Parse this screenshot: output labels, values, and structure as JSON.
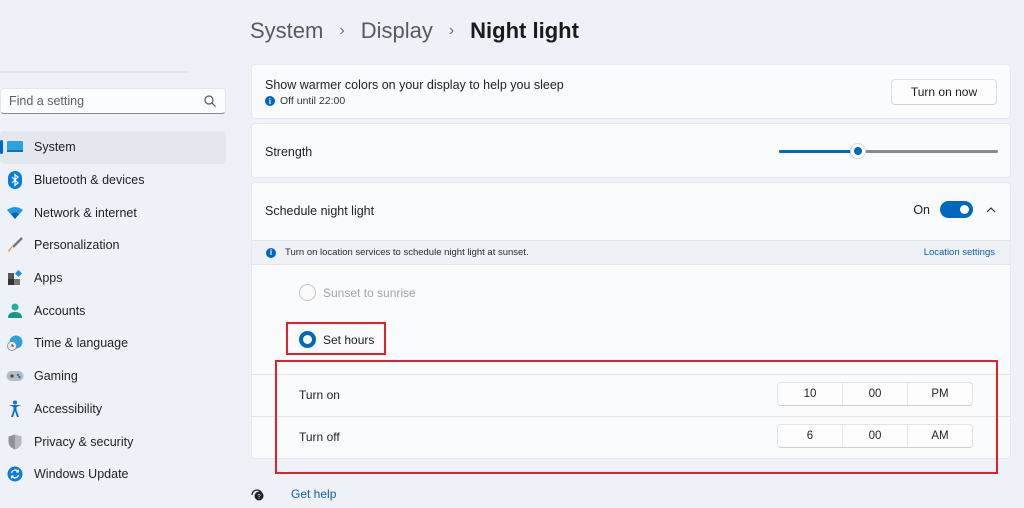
{
  "sidebar": {
    "search": {
      "placeholder": "Find a setting",
      "value": ""
    },
    "items": [
      {
        "label": "System",
        "icon": "monitor-icon",
        "active": true
      },
      {
        "label": "Bluetooth & devices",
        "icon": "bluetooth-icon"
      },
      {
        "label": "Network & internet",
        "icon": "wifi-icon"
      },
      {
        "label": "Personalization",
        "icon": "brush-icon"
      },
      {
        "label": "Apps",
        "icon": "apps-icon"
      },
      {
        "label": "Accounts",
        "icon": "person-icon"
      },
      {
        "label": "Time & language",
        "icon": "globe-clock-icon"
      },
      {
        "label": "Gaming",
        "icon": "gamepad-icon"
      },
      {
        "label": "Accessibility",
        "icon": "accessibility-icon"
      },
      {
        "label": "Privacy & security",
        "icon": "shield-icon"
      },
      {
        "label": "Windows Update",
        "icon": "update-icon"
      }
    ]
  },
  "breadcrumb": [
    "System",
    "Display",
    "Night light"
  ],
  "night_light": {
    "description": "Show warmer colors on your display to help you sleep",
    "status": "Off until 22:00",
    "turn_on_button": "Turn on now"
  },
  "strength": {
    "label": "Strength",
    "value_percent": 36
  },
  "schedule": {
    "label": "Schedule night light",
    "toggle_state": "On",
    "expanded": true,
    "info_text": "Turn on location services to schedule night light at sunset.",
    "location_link": "Location settings",
    "options": [
      {
        "label": "Sunset to sunrise",
        "selected": false,
        "disabled": true
      },
      {
        "label": "Set hours",
        "selected": true,
        "disabled": false
      }
    ],
    "turn_on": {
      "label": "Turn on",
      "hour": "10",
      "minute": "00",
      "period": "PM"
    },
    "turn_off": {
      "label": "Turn off",
      "hour": "6",
      "minute": "00",
      "period": "AM"
    }
  },
  "footer": {
    "help_link": "Get help"
  },
  "colors": {
    "accent": "#0067c0",
    "annotation": "#e3202a",
    "background": "#eef2f8"
  }
}
